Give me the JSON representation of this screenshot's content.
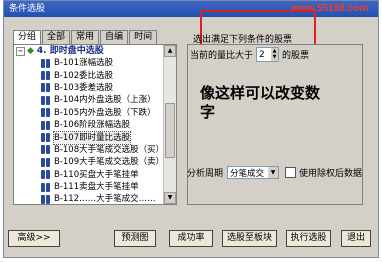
{
  "window": {
    "title": "条件选股",
    "watermark": "www.55188.com"
  },
  "tabs": [
    {
      "label": "分组",
      "active": true
    },
    {
      "label": "全部",
      "active": false
    },
    {
      "label": "常用",
      "active": false
    },
    {
      "label": "自编",
      "active": false
    },
    {
      "label": "时间",
      "active": false
    }
  ],
  "tree": {
    "root_label": "4. 即时盘中选股",
    "expander": "−",
    "items": [
      "B-101涨幅选股",
      "B-102委比选股",
      "B-103委差选股",
      "B-104内外盘选股（上涨）",
      "B-105内外盘选股（下跌）",
      "B-106阶段涨幅选股",
      "B-107即时量比选股",
      "B-108大手笔成交选股（买）",
      "B-109大手笔成交选股（卖）",
      "B-110买盘大手笔挂单",
      "B-111卖盘大手笔挂单",
      "B-112……大手笔成交……"
    ],
    "selected_index": 6
  },
  "right": {
    "hint": "选出满足下列条件的股票",
    "condition_prefix": "当前的量比大于",
    "condition_value": "2",
    "condition_suffix": "的股票",
    "annotation": "像这样可以改变数字",
    "annotation_color": "#e02020",
    "period_label": "分析周期",
    "period_value": "分笔成交",
    "exclude_label": "使用除权后数据"
  },
  "buttons": {
    "advanced": "高级>>",
    "preview": "预测图",
    "success_rate": "成功率",
    "to_block": "选股至板块",
    "run": "执行选股",
    "exit": "退出"
  }
}
